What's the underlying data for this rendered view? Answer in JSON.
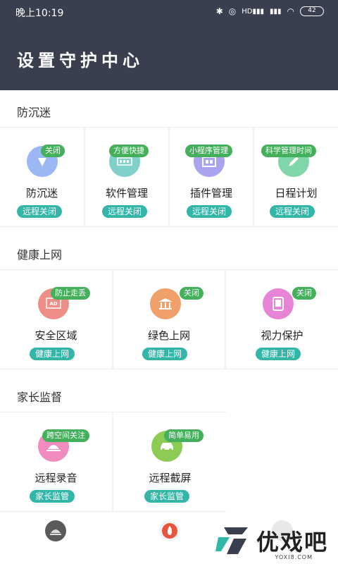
{
  "status_bar": {
    "time": "晚上10:19",
    "signal_label": "HD",
    "battery": "42"
  },
  "header": {
    "title": "设置守护中心"
  },
  "sections": [
    {
      "title": "防沉迷",
      "items": [
        {
          "label": "防沉迷",
          "tag": "关闭",
          "action": "远程关闭",
          "icon": "shield-icon",
          "color": "#9bb8f4"
        },
        {
          "label": "软件管理",
          "tag": "方便快捷",
          "action": "远程关闭",
          "icon": "apps-icon",
          "color": "#7fd1c9"
        },
        {
          "label": "插件管理",
          "tag": "小程序管理",
          "action": "远程关闭",
          "icon": "plugin-icon",
          "color": "#a9a3f0"
        },
        {
          "label": "日程计划",
          "tag": "科学管理时间",
          "action": "远程关闭",
          "icon": "pencil-icon",
          "color": "#7fd6a8"
        }
      ]
    },
    {
      "title": "健康上网",
      "items": [
        {
          "label": "安全区域",
          "tag": "防止走丢",
          "action": "健康上网",
          "icon": "ad-board-icon",
          "color": "#ef8d88"
        },
        {
          "label": "绿色上网",
          "tag": "关闭",
          "action": "健康上网",
          "icon": "bank-icon",
          "color": "#f0a06a"
        },
        {
          "label": "视力保护",
          "tag": "关闭",
          "action": "健康上网",
          "icon": "tablet-icon",
          "color": "#e884d8"
        }
      ]
    },
    {
      "title": "家长监督",
      "items": [
        {
          "label": "远程录音",
          "tag": "跨空间关注",
          "action": "家长监管",
          "icon": "microphone-icon",
          "color": "#f08cc0"
        },
        {
          "label": "远程截屏",
          "tag": "简单易用",
          "action": "家长监管",
          "icon": "car-icon",
          "color": "#8ccc55"
        }
      ]
    }
  ],
  "watermark": {
    "brand": "优戏吧",
    "url": "YOXI8.COM"
  }
}
